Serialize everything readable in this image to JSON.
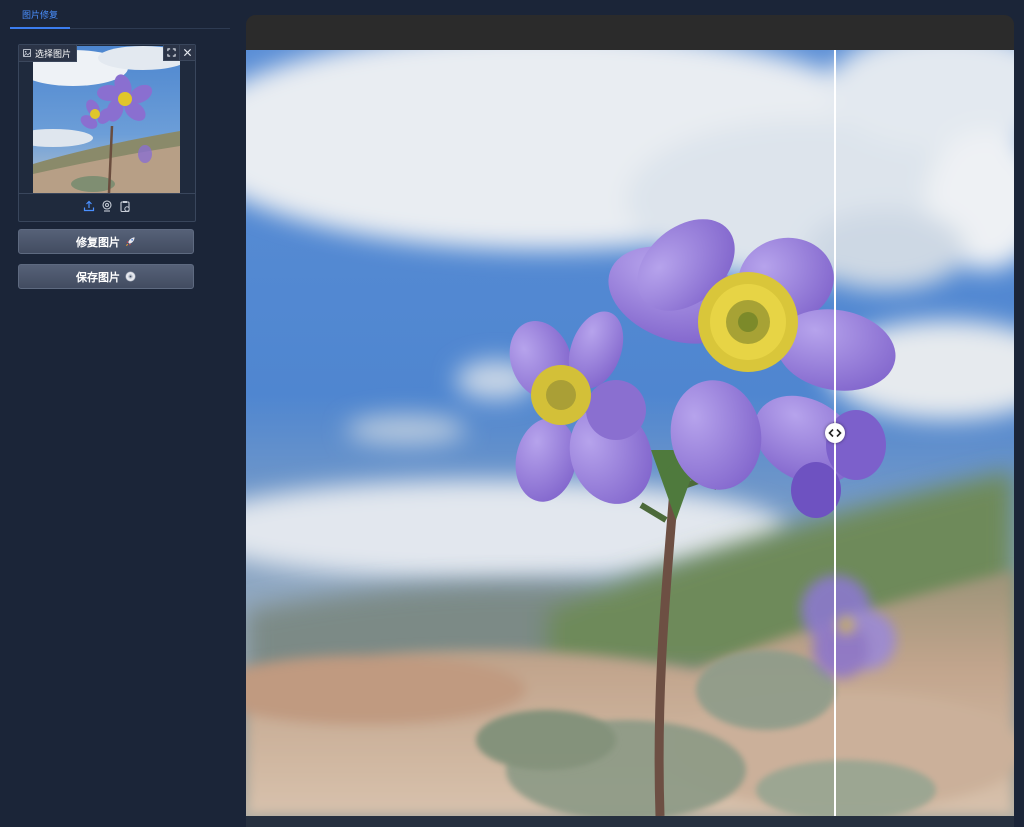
{
  "tabs": [
    {
      "label": "图片修复",
      "active": true
    }
  ],
  "uploader": {
    "label": "选择图片",
    "actions": [
      "fullscreen-icon",
      "close-icon"
    ],
    "sources": [
      "upload-icon",
      "webcam-icon",
      "clipboard-icon"
    ]
  },
  "buttons": {
    "restore": {
      "label": "修复图片",
      "icon": "rocket-icon"
    },
    "save": {
      "label": "保存图片",
      "icon": "cd-disc-icon"
    }
  },
  "viewer": {
    "comparison_slider": true,
    "handle_icon": "left-right-arrows-icon"
  },
  "colors": {
    "background": "#1b2538",
    "accent": "#3b7df0",
    "button": "#4a5469",
    "viewer_bar": "#2b2b2b"
  }
}
